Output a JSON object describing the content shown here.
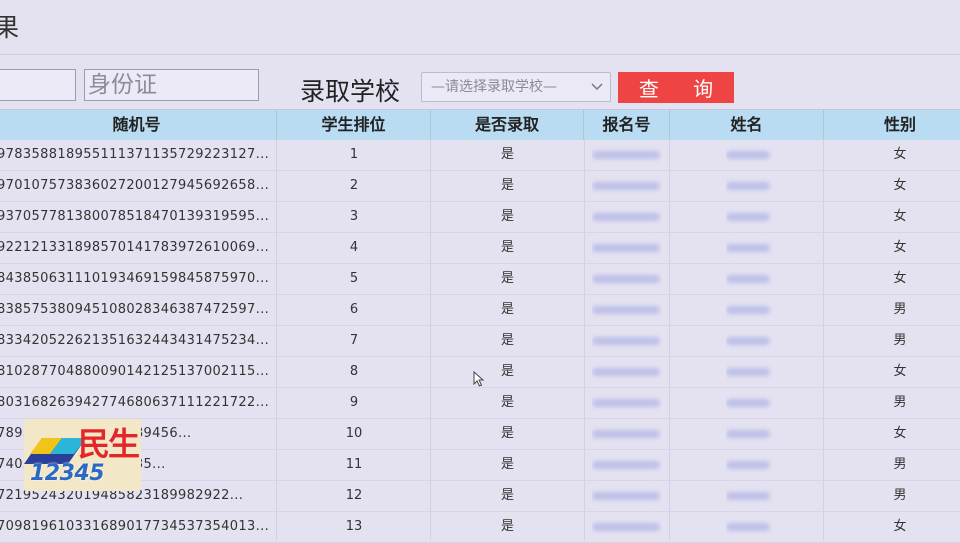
{
  "page": {
    "title_fragment": "果"
  },
  "filters": {
    "field1_value": "",
    "id_field_placeholder": "身份证",
    "school_label": "录取学校",
    "school_select_value": "—请选择录取学校—",
    "query_button": "查 询"
  },
  "table": {
    "headers": [
      "随机号",
      "学生排位",
      "是否录取",
      "报名号",
      "姓名",
      "性别"
    ],
    "rows": [
      {
        "random": "978358818955111371135729223127...",
        "rank": "1",
        "admitted": "是",
        "gender": "女"
      },
      {
        "random": "970107573836027200127945692658...",
        "rank": "2",
        "admitted": "是",
        "gender": "女"
      },
      {
        "random": "937057781380078518470139319595...",
        "rank": "3",
        "admitted": "是",
        "gender": "女"
      },
      {
        "random": "922121331898570141783972610069...",
        "rank": "4",
        "admitted": "是",
        "gender": "女"
      },
      {
        "random": "843850631110193469159845875970...",
        "rank": "5",
        "admitted": "是",
        "gender": "女"
      },
      {
        "random": "838575380945108028346387472597...",
        "rank": "6",
        "admitted": "是",
        "gender": "男"
      },
      {
        "random": "833420522621351632443431475234...",
        "rank": "7",
        "admitted": "是",
        "gender": "男"
      },
      {
        "random": "810287704880090142125137002115...",
        "rank": "8",
        "admitted": "是",
        "gender": "女"
      },
      {
        "random": "803168263942774680637111221722...",
        "rank": "9",
        "admitted": "是",
        "gender": "男"
      },
      {
        "random": "789544224241001989456...",
        "rank": "10",
        "admitted": "是",
        "gender": "女"
      },
      {
        "random": "740577714896951835...",
        "rank": "11",
        "admitted": "是",
        "gender": "男"
      },
      {
        "random": "721952432019485823189982922...",
        "rank": "12",
        "admitted": "是",
        "gender": "男"
      },
      {
        "random": "709819610331689017734537354013...",
        "rank": "13",
        "admitted": "是",
        "gender": "女"
      }
    ]
  },
  "logo": {
    "text": "民生",
    "number": "12345"
  },
  "colors": {
    "header_bg": "#b9dcf3",
    "query_button": "#ef4444",
    "page_bg": "#e4e2f1"
  }
}
